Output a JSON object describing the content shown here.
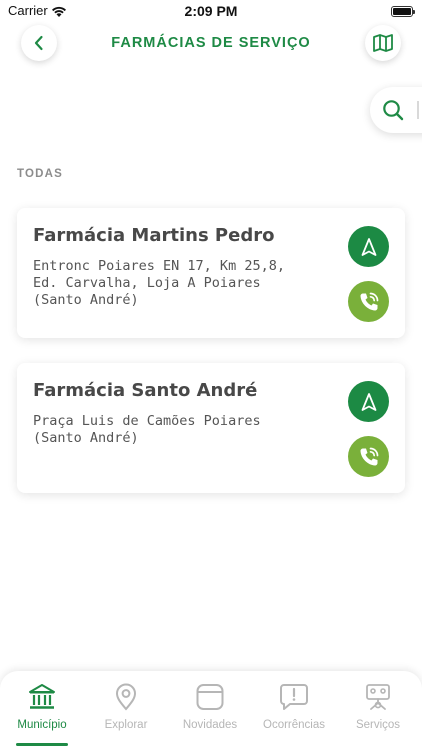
{
  "status_bar": {
    "carrier": "Carrier",
    "time": "2:09 PM"
  },
  "header": {
    "title": "FARMÁCIAS DE SERVIÇO",
    "back_icon": "chevron-left-icon",
    "map_icon": "map-icon"
  },
  "search": {
    "icon": "search-icon",
    "value": ""
  },
  "section": {
    "label": "TODAS"
  },
  "pharmacies": [
    {
      "name": "Farmácia Martins Pedro",
      "address_lines": [
        "Entronc Poiares EN 17, Km 25,8,",
        "Ed. Carvalha, Loja A Poiares",
        "(Santo André)"
      ]
    },
    {
      "name": "Farmácia Santo André",
      "address_lines": [
        "Praça Luis de Camões Poiares",
        "(Santo André)"
      ]
    }
  ],
  "tabs": [
    {
      "label": "Município",
      "icon": "bank-icon",
      "active": true
    },
    {
      "label": "Explorar",
      "icon": "location-pin-icon",
      "active": false
    },
    {
      "label": "Novidades",
      "icon": "news-icon",
      "active": false
    },
    {
      "label": "Ocorrências",
      "icon": "alert-bubble-icon",
      "active": false
    },
    {
      "label": "Serviços",
      "icon": "services-icon",
      "active": false
    }
  ],
  "colors": {
    "primary": "#1e8a45",
    "secondary": "#7ab03a",
    "inactive": "#b6b6b6"
  }
}
